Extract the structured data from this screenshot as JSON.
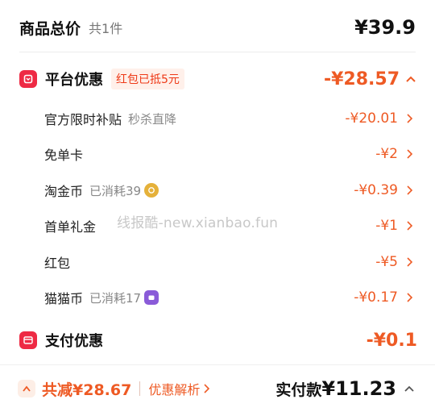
{
  "summary": {
    "total_label": "商品总价",
    "count": "共1件",
    "total_amount": "¥39.9"
  },
  "platform_discount": {
    "title": "平台优惠",
    "tag": "红包已抵5元",
    "amount": "-¥28.57",
    "items": [
      {
        "label": "官方限时补贴",
        "sub": "秒杀直降",
        "amount": "-¥20.01"
      },
      {
        "label": "免单卡",
        "sub": "",
        "amount": "-¥2"
      },
      {
        "label": "淘金币",
        "sub": "已消耗39",
        "amount": "-¥0.39"
      },
      {
        "label": "首单礼金",
        "sub": "",
        "amount": "-¥1"
      },
      {
        "label": "红包",
        "sub": "",
        "amount": "-¥5"
      },
      {
        "label": "猫猫币",
        "sub": "已消耗17",
        "amount": "-¥0.17"
      }
    ]
  },
  "payment_discount": {
    "title": "支付优惠",
    "amount": "-¥0.1"
  },
  "watermark": "线报酷-new.xianbao.fun",
  "footer": {
    "savings": "共减¥28.67",
    "analysis_label": "优惠解析",
    "pay_label": "实付款",
    "pay_amount": "¥11.23"
  },
  "icons": {
    "platform": "red-envelope-icon",
    "payment": "card-icon",
    "taojinbi_badge": "coin-icon",
    "maomao_badge": "cat-coin-icon"
  },
  "colors": {
    "accent": "#ee5a24",
    "brand_red": "#ee2a44",
    "tag_bg": "#fff0ea"
  }
}
